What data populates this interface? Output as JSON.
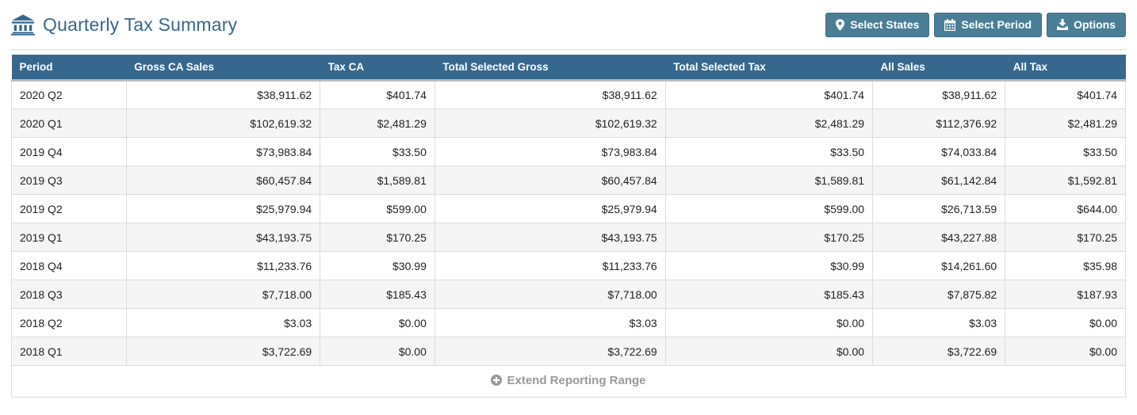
{
  "colors": {
    "title": "#36678d",
    "button_bg": "#4a7e96",
    "table_header_bg": "#36688e",
    "row_alt_bg": "#f5f5f5",
    "cell_border": "#dddddd",
    "header_divider": "#bdbdbd",
    "footer_text": "#999999"
  },
  "header": {
    "title": "Quarterly Tax Summary",
    "buttons": [
      {
        "label": "Select States",
        "icon": "map-marker-icon"
      },
      {
        "label": "Select Period",
        "icon": "calendar-icon"
      },
      {
        "label": "Options",
        "icon": "download-icon"
      }
    ]
  },
  "table": {
    "columns": [
      "Period",
      "Gross CA Sales",
      "Tax CA",
      "Total Selected Gross",
      "Total Selected Tax",
      "All Sales",
      "All Tax"
    ],
    "column_keys": [
      "period",
      "gross-ca-sales",
      "tax-ca",
      "total-selected-gross",
      "total-selected-tax",
      "all-sales",
      "all-tax"
    ],
    "rows": [
      [
        "2020 Q2",
        "$38,911.62",
        "$401.74",
        "$38,911.62",
        "$401.74",
        "$38,911.62",
        "$401.74"
      ],
      [
        "2020 Q1",
        "$102,619.32",
        "$2,481.29",
        "$102,619.32",
        "$2,481.29",
        "$112,376.92",
        "$2,481.29"
      ],
      [
        "2019 Q4",
        "$73,983.84",
        "$33.50",
        "$73,983.84",
        "$33.50",
        "$74,033.84",
        "$33.50"
      ],
      [
        "2019 Q3",
        "$60,457.84",
        "$1,589.81",
        "$60,457.84",
        "$1,589.81",
        "$61,142.84",
        "$1,592.81"
      ],
      [
        "2019 Q2",
        "$25,979.94",
        "$599.00",
        "$25,979.94",
        "$599.00",
        "$26,713.59",
        "$644.00"
      ],
      [
        "2019 Q1",
        "$43,193.75",
        "$170.25",
        "$43,193.75",
        "$170.25",
        "$43,227.88",
        "$170.25"
      ],
      [
        "2018 Q4",
        "$11,233.76",
        "$30.99",
        "$11,233.76",
        "$30.99",
        "$14,261.60",
        "$35.98"
      ],
      [
        "2018 Q3",
        "$7,718.00",
        "$185.43",
        "$7,718.00",
        "$185.43",
        "$7,875.82",
        "$187.93"
      ],
      [
        "2018 Q2",
        "$3.03",
        "$0.00",
        "$3.03",
        "$0.00",
        "$3.03",
        "$0.00"
      ],
      [
        "2018 Q1",
        "$3,722.69",
        "$0.00",
        "$3,722.69",
        "$0.00",
        "$3,722.69",
        "$0.00"
      ]
    ],
    "footer": {
      "label": "Extend Reporting Range"
    }
  }
}
